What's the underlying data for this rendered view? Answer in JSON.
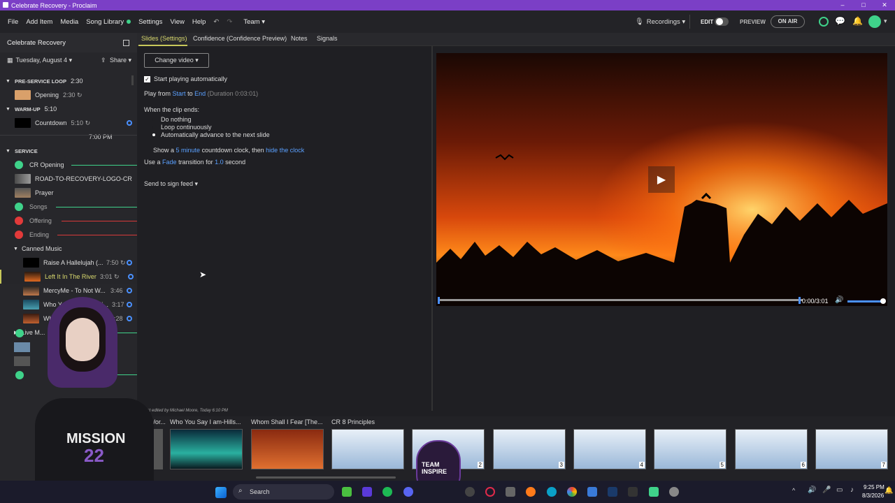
{
  "window": {
    "title": "Celebrate Recovery - Proclaim",
    "controls": [
      "–",
      "□",
      "✕"
    ]
  },
  "menu": {
    "items": [
      "File",
      "Add Item",
      "Media",
      "Song Library",
      "Settings",
      "View",
      "Help"
    ],
    "team": "Team ▾",
    "recordings": "Recordings ▾",
    "edit": "EDIT",
    "preview": "PREVIEW",
    "onair": "ON AIR"
  },
  "sidebar": {
    "service_title": "Celebrate Recovery",
    "date": "Tuesday, August 4 ▾",
    "share": "Share ▾",
    "preservice": {
      "label": "PRE-SERVICE LOOP",
      "dur": "2:30"
    },
    "opening": {
      "label": "Opening",
      "dur": "2:30 ↻"
    },
    "warmup": {
      "label": "WARM-UP",
      "dur": "5:10"
    },
    "countdown": {
      "label": "Countdown",
      "dur": "5:10 ↻"
    },
    "time": "7:00 PM",
    "service": {
      "label": "SERVICE"
    },
    "items": [
      "CR Opening",
      "ROAD-TO-RECOVERY-LOGO-CR",
      "Prayer",
      "Songs",
      "Offering",
      "Ending"
    ],
    "canned": "Canned Music",
    "songs": [
      {
        "label": "Raise A Hallelujah (...",
        "dur": "7:50 ↻"
      },
      {
        "label": "Left It In The River",
        "dur": "3:01 ↻"
      },
      {
        "label": "MercyMe - To Not W...",
        "dur": "3:46"
      },
      {
        "label": "Who You Say I am-Hi...",
        "dur": "3:17"
      },
      {
        "label": "Wh...             r [T...",
        "dur": "4:28"
      }
    ],
    "live": "Live M..."
  },
  "tabs": [
    "Slides (Settings)",
    "Confidence (Confidence Preview)",
    "Notes",
    "Signals"
  ],
  "settings": {
    "change_video": "Change video ▾",
    "start_auto": "Start playing automatically",
    "play_from": "Play from",
    "start": "Start",
    "to": "to",
    "end": "End",
    "duration": "(Duration 0:03:01)",
    "when_ends": "When the clip ends:",
    "opt1": "Do nothing",
    "opt2": "Loop continuously",
    "opt3": "Automatically advance to the next slide",
    "show_a": "Show a",
    "five_min": "5 minute",
    "countdown_then": "countdown clock, then",
    "hide_clock": "hide the clock",
    "use_a": "Use a",
    "fade": "Fade",
    "transition_for": "transition for",
    "sec_val": "1.0",
    "second": "second",
    "send": "Send to sign feed ▾"
  },
  "player": {
    "time": "0:00/3:01"
  },
  "strip": {
    "edited": "Last edited by Michael Moore, Today 6:10 PM",
    "labels": [
      "...Wor...",
      "Who You Say I am-Hills...",
      "Whom Shall I Fear [The...",
      "CR 8 Principles"
    ],
    "nums": [
      "2",
      "3",
      "4",
      "5",
      "6",
      "7"
    ]
  },
  "taskbar": {
    "search": "Search",
    "time": "9:25 PM",
    "date": "8/3/2026"
  },
  "overlay": {
    "shirt1": "MISSION",
    "shirt2": "22",
    "logo": "TEAM INSPIRE"
  }
}
